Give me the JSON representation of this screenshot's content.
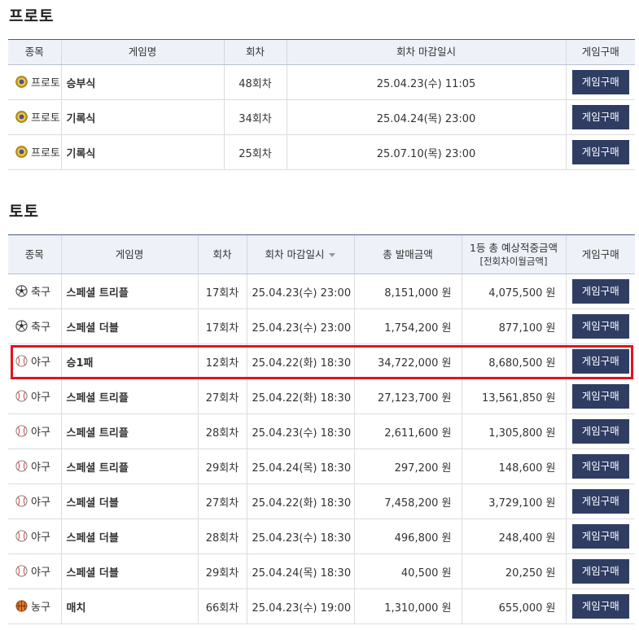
{
  "proto": {
    "title": "프로토",
    "headers": [
      "종목",
      "게임명",
      "회차",
      "회차 마감일시",
      "게임구매"
    ],
    "rows": [
      {
        "sport": "프로토",
        "sport_icon": "target-icon",
        "game": "승부식",
        "round": "48회차",
        "deadline": "25.04.23(수) 11:05",
        "buy": "게임구매"
      },
      {
        "sport": "프로토",
        "sport_icon": "target-icon",
        "game": "기록식",
        "round": "34회차",
        "deadline": "25.04.24(목) 23:00",
        "buy": "게임구매"
      },
      {
        "sport": "프로토",
        "sport_icon": "target-icon",
        "game": "기록식",
        "round": "25회차",
        "deadline": "25.07.10(목) 23:00",
        "buy": "게임구매"
      }
    ]
  },
  "toto": {
    "title": "토토",
    "headers": {
      "sport": "종목",
      "game": "게임명",
      "round": "회차",
      "deadline": "회차 마감일시",
      "total_sales": "총 발매금액",
      "prize_line1": "1등 총 예상적중금액",
      "prize_line2": "[전회차이월금액]",
      "buy": "게임구매"
    },
    "rows": [
      {
        "sport": "축구",
        "sport_icon": "soccer-ball-icon",
        "game": "스페셜 트리플",
        "round": "17회차",
        "deadline": "25.04.23(수) 23:00",
        "total_sales": "8,151,000 원",
        "prize": "4,075,500 원",
        "buy": "게임구매"
      },
      {
        "sport": "축구",
        "sport_icon": "soccer-ball-icon",
        "game": "스페셜 더블",
        "round": "17회차",
        "deadline": "25.04.23(수) 23:00",
        "total_sales": "1,754,200 원",
        "prize": "877,100 원",
        "buy": "게임구매"
      },
      {
        "sport": "야구",
        "sport_icon": "baseball-icon",
        "game": "승1패",
        "round": "12회차",
        "deadline": "25.04.22(화) 18:30",
        "total_sales": "34,722,000 원",
        "prize": "8,680,500 원",
        "buy": "게임구매"
      },
      {
        "sport": "야구",
        "sport_icon": "baseball-icon",
        "game": "스페셜 트리플",
        "round": "27회차",
        "deadline": "25.04.22(화) 18:30",
        "total_sales": "27,123,700 원",
        "prize": "13,561,850 원",
        "buy": "게임구매"
      },
      {
        "sport": "야구",
        "sport_icon": "baseball-icon",
        "game": "스페셜 트리플",
        "round": "28회차",
        "deadline": "25.04.23(수) 18:30",
        "total_sales": "2,611,600 원",
        "prize": "1,305,800 원",
        "buy": "게임구매"
      },
      {
        "sport": "야구",
        "sport_icon": "baseball-icon",
        "game": "스페셜 트리플",
        "round": "29회차",
        "deadline": "25.04.24(목) 18:30",
        "total_sales": "297,200 원",
        "prize": "148,600 원",
        "buy": "게임구매"
      },
      {
        "sport": "야구",
        "sport_icon": "baseball-icon",
        "game": "스페셜 더블",
        "round": "27회차",
        "deadline": "25.04.22(화) 18:30",
        "total_sales": "7,458,200 원",
        "prize": "3,729,100 원",
        "buy": "게임구매"
      },
      {
        "sport": "야구",
        "sport_icon": "baseball-icon",
        "game": "스페셜 더블",
        "round": "28회차",
        "deadline": "25.04.23(수) 18:30",
        "total_sales": "496,800 원",
        "prize": "248,400 원",
        "buy": "게임구매"
      },
      {
        "sport": "야구",
        "sport_icon": "baseball-icon",
        "game": "스페셜 더블",
        "round": "29회차",
        "deadline": "25.04.24(목) 18:30",
        "total_sales": "40,500 원",
        "prize": "20,250 원",
        "buy": "게임구매"
      },
      {
        "sport": "농구",
        "sport_icon": "basketball-icon",
        "game": "매치",
        "round": "66회차",
        "deadline": "25.04.23(수) 19:00",
        "total_sales": "1,310,000 원",
        "prize": "655,000 원",
        "buy": "게임구매"
      }
    ]
  },
  "highlighted_row_index": 2,
  "colors": {
    "button_bg": "#2f3d63",
    "header_bg": "#eef1f8",
    "highlight": "#e0151f"
  }
}
